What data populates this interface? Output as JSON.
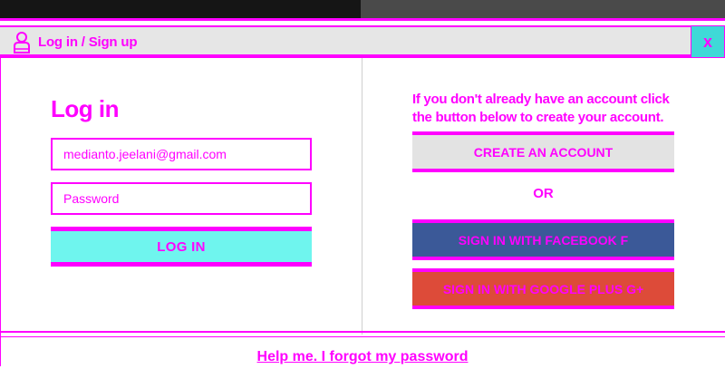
{
  "modal": {
    "title": "Log in / Sign up",
    "close_label": "x"
  },
  "login": {
    "heading": "Log in",
    "email_value": "medianto.jeelani@gmail.com",
    "password_placeholder": "Password",
    "login_button": "LOG IN"
  },
  "signup": {
    "prompt": "If you don't already have an account click the button below to create your account.",
    "create_button": "CREATE AN ACCOUNT",
    "or_text": "OR",
    "facebook_button": "SIGN IN WITH FACEBOOK f",
    "google_button": "SIGN IN WITH GOOGLE PLUS G+"
  },
  "footer": {
    "forgot_link": "Help me. I forgot my password"
  },
  "colors": {
    "accent": "#ff00ff",
    "login_button": "#6ff5ee",
    "facebook": "#3b5998",
    "google": "#dd4b39"
  }
}
